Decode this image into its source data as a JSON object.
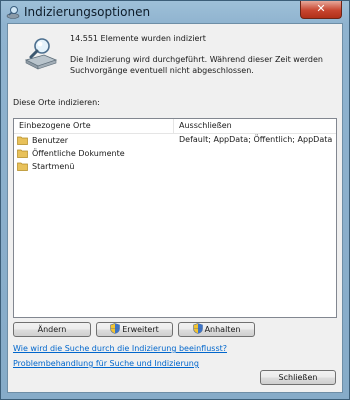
{
  "window": {
    "title": "Indizierungsoptionen",
    "close_label": "✕"
  },
  "status": {
    "count_text": "14.551 Elemente wurden indiziert",
    "info_text": "Die Indizierung wird durchgeführt. Während dieser Zeit werden Suchvorgänge eventuell nicht abgeschlossen."
  },
  "locations": {
    "label": "Diese Orte indizieren:",
    "columns": [
      "Einbezogene Orte",
      "Ausschließen"
    ],
    "rows": [
      {
        "name": "Benutzer",
        "exclude": "Default; AppData; Öffentlich; AppData"
      },
      {
        "name": "Öffentliche Dokumente",
        "exclude": ""
      },
      {
        "name": "Startmenü",
        "exclude": ""
      }
    ]
  },
  "buttons": {
    "modify": "Ändern",
    "advanced": "Erweitert",
    "pause": "Anhalten",
    "close": "Schließen"
  },
  "links": {
    "how_search": "Wie wird die Suche durch die Indizierung beeinflusst?",
    "troubleshoot": "Problembehandlung für Suche und Indizierung"
  },
  "colors": {
    "link": "#0066cc",
    "folder": "#e8c15a"
  }
}
